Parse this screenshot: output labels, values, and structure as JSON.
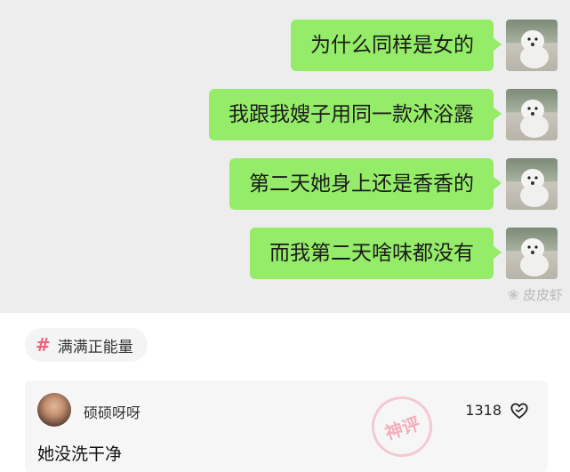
{
  "chat": {
    "messages": [
      {
        "text": "为什么同样是女的"
      },
      {
        "text": "我跟我嫂子用同一款沐浴露"
      },
      {
        "text": "第二天她身上还是香香的"
      },
      {
        "text": "而我第二天啥味都没有"
      }
    ],
    "watermark": "皮皮虾"
  },
  "tag": {
    "label": "满满正能量",
    "icon": "hash-icon"
  },
  "comment": {
    "username": "硕硕呀呀",
    "text": "她没洗干净",
    "likes": "1318",
    "stamp": "神评"
  },
  "colors": {
    "chat_bg": "#ededed",
    "bubble": "#95ec69",
    "accent_pink": "#f2607c"
  }
}
